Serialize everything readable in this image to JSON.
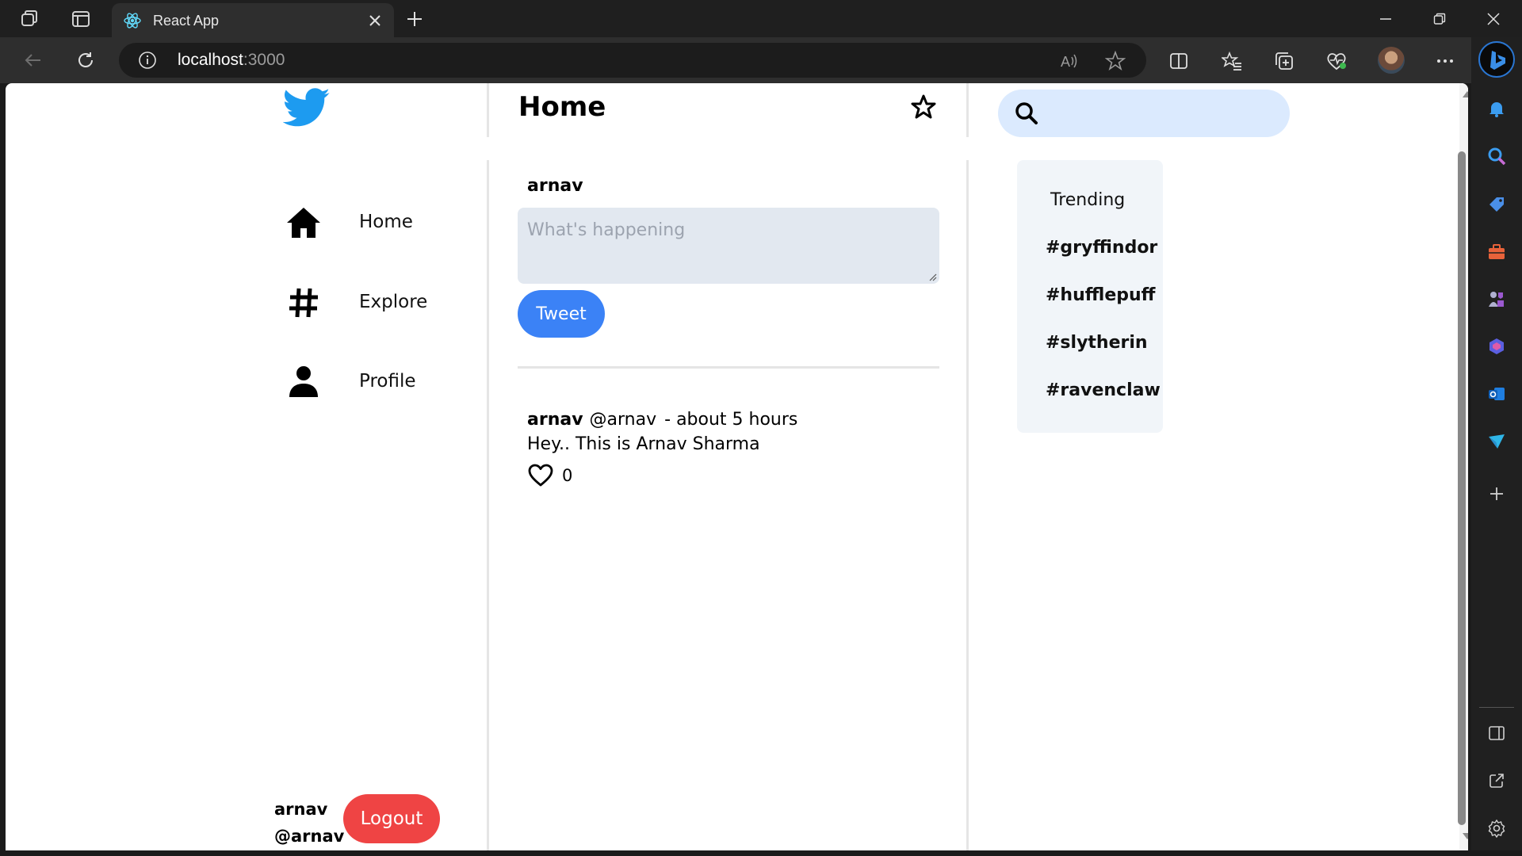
{
  "browser": {
    "tab_title": "React App",
    "url_host": "localhost",
    "url_port": ":3000"
  },
  "app": {
    "nav": [
      {
        "label": "Home",
        "icon": "home-icon"
      },
      {
        "label": "Explore",
        "icon": "hashtag-icon"
      },
      {
        "label": "Profile",
        "icon": "person-icon"
      }
    ],
    "user": {
      "name": "arnav",
      "handle": "@arnav",
      "logout_label": "Logout"
    },
    "header": {
      "title": "Home"
    },
    "composer": {
      "username": "arnav",
      "placeholder": "What's happening",
      "tweet_label": "Tweet"
    },
    "feed": [
      {
        "name": "arnav",
        "handle": "@arnav",
        "time": "- about 5 hours",
        "text": "Hey.. This is Arnav Sharma",
        "likes": "0"
      }
    ],
    "search": {
      "placeholder": ""
    },
    "trending": {
      "title": "Trending",
      "items": [
        "#gryffindor",
        "#hufflepuff",
        "#slytherin",
        "#ravenclaw"
      ]
    },
    "colors": {
      "twitter_blue": "#1d9bf0",
      "tweet_button": "#3b82f6",
      "logout_button": "#ef4444",
      "search_bg": "#dbeafe",
      "composer_bg": "#e2e8f0",
      "trending_bg": "#f1f5f9"
    }
  }
}
